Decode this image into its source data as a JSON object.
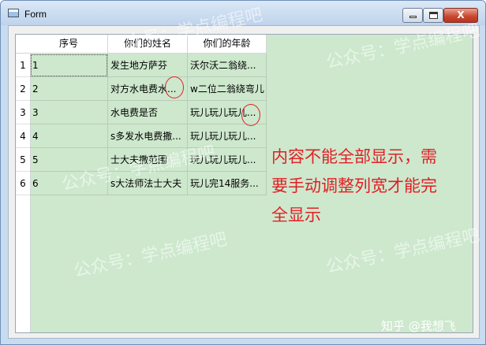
{
  "window": {
    "title": "Form",
    "close_glyph": "X",
    "icons": {
      "app": "window-app-icon",
      "minimize": "minimize-icon",
      "maximize": "maximize-icon",
      "close": "close-icon"
    }
  },
  "table": {
    "columns": [
      "序号",
      "你们的姓名",
      "你们的年龄"
    ],
    "row_headers": [
      "1",
      "2",
      "3",
      "4",
      "5",
      "6"
    ],
    "rows": [
      [
        "1",
        "发生地方萨芬",
        "沃尔沃二翁绕..."
      ],
      [
        "2",
        "对方水电费水...",
        "w二位二翁绕弯儿"
      ],
      [
        "3",
        "水电费是否",
        "玩儿玩儿玩儿..."
      ],
      [
        "4",
        "s多发水电费撒...",
        "玩儿玩儿玩儿..."
      ],
      [
        "5",
        "士大夫撒范围",
        "玩儿玩儿玩儿..."
      ],
      [
        "6",
        "s大法师法士大夫",
        "玩儿完14服务..."
      ]
    ],
    "background_color": "#cde8cd"
  },
  "annotation": {
    "lines": [
      "内容不能全部显示，需",
      "要手动调整列宽才能完",
      "全显示"
    ],
    "color": "#e31e24"
  },
  "watermark": {
    "text": "公众号：学点编程吧",
    "credit": "知乎 @我想飞"
  }
}
